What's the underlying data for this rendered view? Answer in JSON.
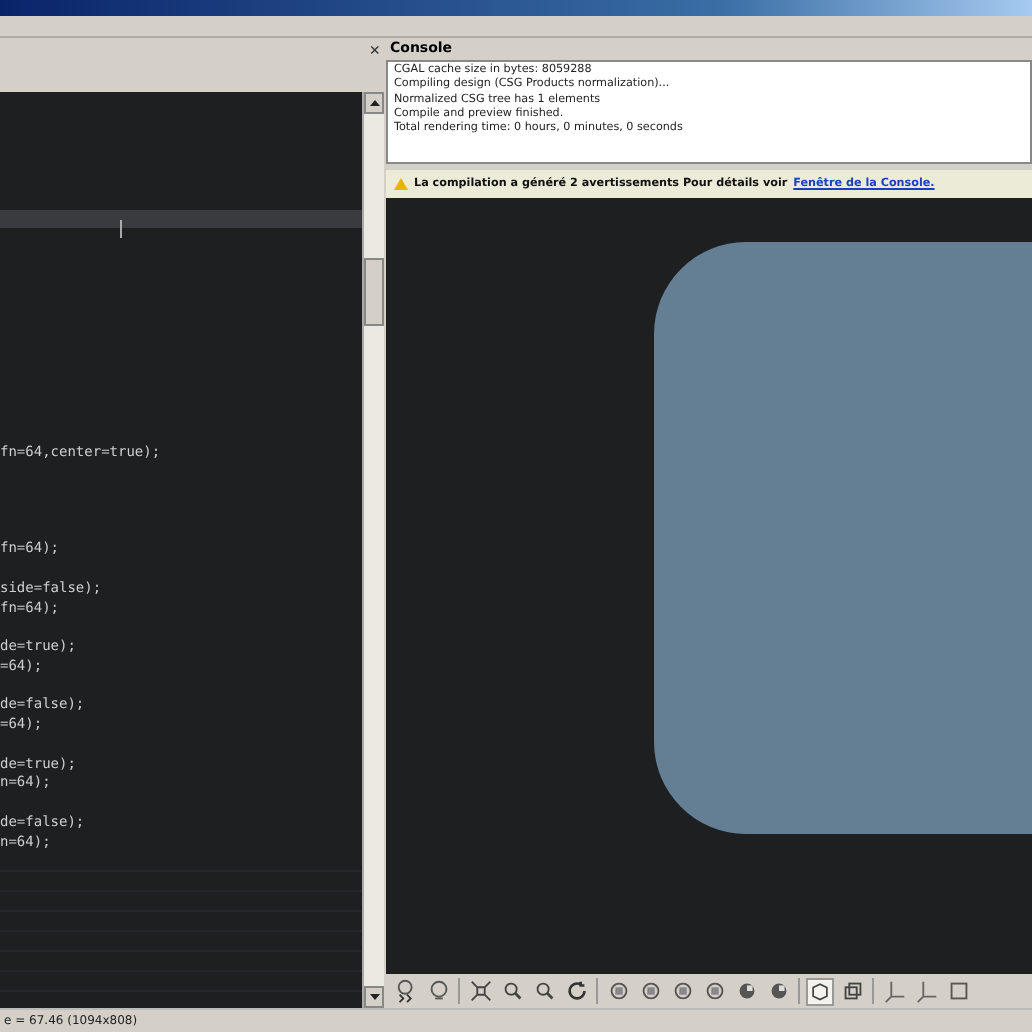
{
  "editor": {
    "lines": [
      {
        "kind": "blank",
        "current": false
      },
      {
        "kind": "blank",
        "current": false
      },
      {
        "kind": "blank",
        "current": false
      },
      {
        "kind": "blank",
        "current": false
      },
      {
        "kind": "blank",
        "current": false
      },
      {
        "kind": "blank",
        "current": false
      },
      {
        "kind": "blank",
        "current": true
      },
      {
        "kind": "blank",
        "current": false
      },
      {
        "kind": "blank",
        "current": false
      },
      {
        "kind": "blank",
        "current": false
      },
      {
        "kind": "blank",
        "current": false
      },
      {
        "kind": "blank",
        "current": false
      },
      {
        "kind": "blank",
        "current": false
      },
      {
        "kind": "blank",
        "current": false
      },
      {
        "kind": "blank",
        "current": false
      },
      {
        "kind": "blank",
        "current": false
      },
      {
        "kind": "blank",
        "current": false
      },
      {
        "kind": "blank",
        "current": false
      },
      {
        "kind": "code",
        "current": false,
        "text": "fn=64,center=true);"
      },
      {
        "kind": "blank",
        "current": false
      },
      {
        "kind": "blank",
        "current": false
      },
      {
        "kind": "blank",
        "current": false
      },
      {
        "kind": "blank",
        "current": false
      },
      {
        "kind": "code",
        "current": false,
        "text": "fn=64);"
      },
      {
        "kind": "blank",
        "current": false
      },
      {
        "kind": "code",
        "current": false,
        "text": "side=false);"
      },
      {
        "kind": "code",
        "current": false,
        "text": "fn=64);"
      },
      {
        "kind": "blank",
        "current": false
      },
      {
        "kind": "code",
        "current": false,
        "text": "de=true);"
      },
      {
        "kind": "code",
        "current": false,
        "text": "=64);"
      },
      {
        "kind": "blank",
        "current": false
      },
      {
        "kind": "code",
        "current": false,
        "text": "de=false);"
      },
      {
        "kind": "code",
        "current": false,
        "text": "=64);"
      },
      {
        "kind": "blank",
        "current": false
      },
      {
        "kind": "code",
        "current": false,
        "text": "de=true);"
      },
      {
        "kind": "code",
        "current": false,
        "text": "n=64);"
      },
      {
        "kind": "blank",
        "current": false
      },
      {
        "kind": "code",
        "current": false,
        "text": "de=false);"
      },
      {
        "kind": "code",
        "current": false,
        "text": "n=64);"
      }
    ]
  },
  "close_label": "×",
  "console": {
    "title": "Console",
    "lines": [
      "CGAL cache size in bytes: 8059288",
      "Compiling design (CSG Products normalization)...",
      "Normalized CSG tree has 1 elements",
      "Compile and preview finished.",
      "Total rendering time: 0 hours, 0 minutes, 0 seconds"
    ]
  },
  "warning": {
    "text": "La compilation a généré 2 avertissements Pour détails voir",
    "link": "Fenêtre de la Console."
  },
  "toolbar": [
    {
      "kind": "render"
    },
    {
      "kind": "preview"
    },
    {
      "kind": "sep"
    },
    {
      "kind": "zoom-all"
    },
    {
      "kind": "zoom-in"
    },
    {
      "kind": "zoom-out"
    },
    {
      "kind": "reset"
    },
    {
      "kind": "sep"
    },
    {
      "kind": "view"
    },
    {
      "kind": "view"
    },
    {
      "kind": "view"
    },
    {
      "kind": "view"
    },
    {
      "kind": "view-solid"
    },
    {
      "kind": "view-solid"
    },
    {
      "kind": "sep"
    },
    {
      "kind": "perspective"
    },
    {
      "kind": "orthogonal"
    },
    {
      "kind": "sep"
    },
    {
      "kind": "axes"
    },
    {
      "kind": "axes"
    },
    {
      "kind": "edges"
    }
  ],
  "status": "e = 67.46 (1094x808)"
}
